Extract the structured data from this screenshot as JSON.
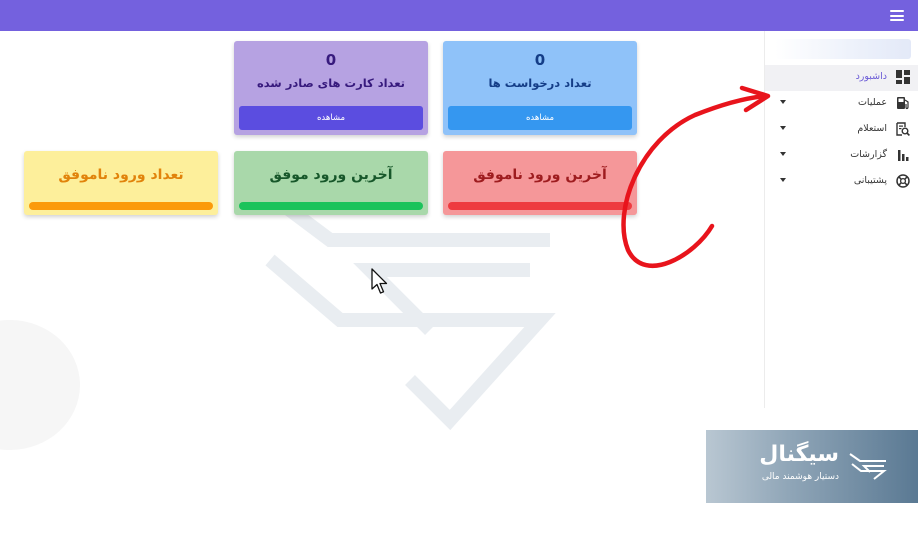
{
  "topbar": {
    "menu_icon": "hamburger-menu-icon",
    "color": "#7461de"
  },
  "sidebar": {
    "items": [
      {
        "label": "داشبورد",
        "icon": "dashboard-icon",
        "active": true
      },
      {
        "label": "عملیات",
        "icon": "fuel-pump-icon",
        "expandable": true
      },
      {
        "label": "استعلام",
        "icon": "document-search-icon",
        "expandable": true
      },
      {
        "label": "گزارشات",
        "icon": "bar-chart-icon",
        "expandable": true
      },
      {
        "label": "پشتیبانی",
        "icon": "support-icon",
        "expandable": true
      }
    ]
  },
  "cards": {
    "requests": {
      "count": "0",
      "title": "تعداد درخواست ها",
      "button": "مشاهده",
      "bg": "#8fc2f9",
      "button_color": "#3597f0",
      "text_color": "#143d87"
    },
    "issued_cards": {
      "count": "0",
      "title": "تعداد کارت های صادر شده",
      "button": "مشاهده",
      "bg": "#b6a2e2",
      "button_color": "#5b4de0",
      "text_color": "#371a7d"
    },
    "last_failed_login": {
      "title": "آخرین ورود ناموفق",
      "bg": "#f59799",
      "bar_color": "#ee3b3f",
      "text_color": "#9e1c1f"
    },
    "last_success_login": {
      "title": "آخرین ورود موفق",
      "bg": "#a9d8aa",
      "bar_color": "#1bc35b",
      "text_color": "#17572a"
    },
    "failed_login_count": {
      "title": "تعداد ورود ناموفق",
      "bg": "#fdef9b",
      "bar_color": "#fb9a0b",
      "text_color": "#e1830b"
    }
  },
  "banner": {
    "name": "سیگنال",
    "subtitle": "دستیار هوشمند مالی",
    "logo_icon": "signal-logo-icon"
  },
  "overlay": {
    "arrow_icon": "red-curved-arrow-icon",
    "arrow_color": "#e8141c",
    "cursor_icon": "mouse-pointer-icon"
  }
}
